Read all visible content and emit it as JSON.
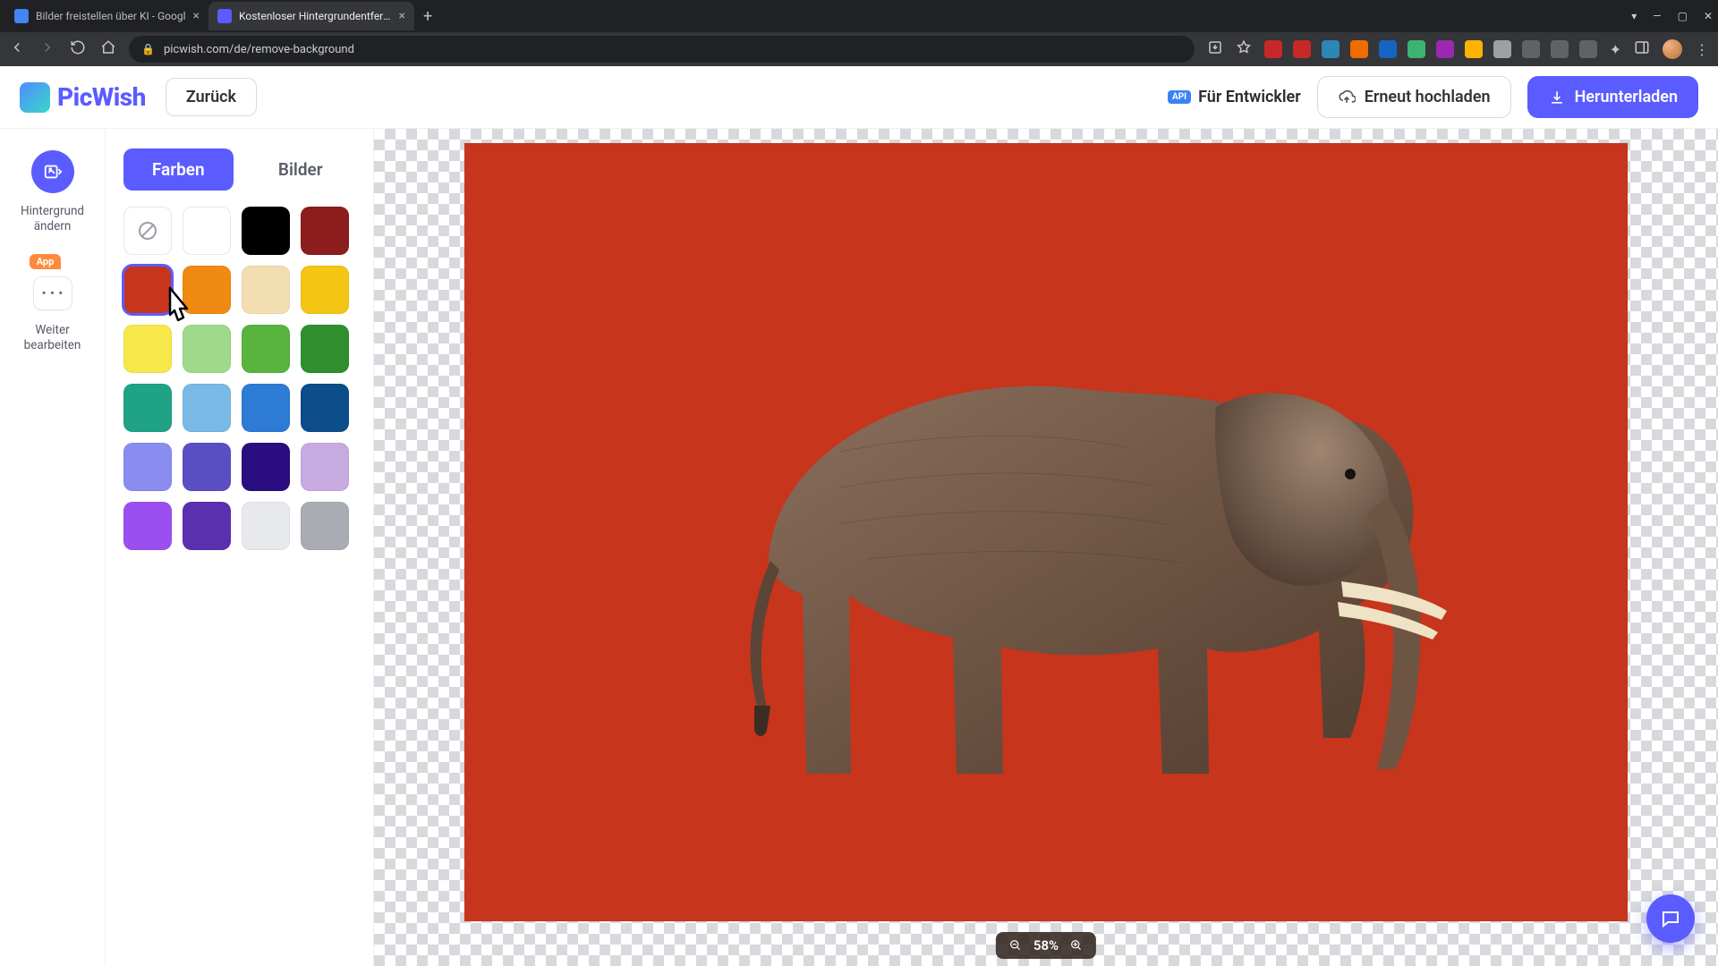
{
  "browser": {
    "tabs": [
      {
        "title": "Bilder freistellen über KI - Googl",
        "active": false,
        "favicon_bg": "#4285f4"
      },
      {
        "title": "Kostenloser Hintergrundentferne",
        "active": true,
        "favicon_bg": "#5b5cff"
      }
    ],
    "url": "picwish.com/de/remove-background",
    "ext_colors": [
      "#c62828",
      "#c62828",
      "#2b87b3",
      "#ef6c00",
      "#1565c0",
      "#3cb371",
      "#9c27b0",
      "#ffb300",
      "#9aa0a6",
      "#5f6368",
      "#5f6368",
      "#5f6368"
    ]
  },
  "header": {
    "logo_text": "PicWish",
    "back_label": "Zurück",
    "dev_badge": "API",
    "dev_label": "Für Entwickler",
    "reupload_label": "Erneut hochladen",
    "download_label": "Herunterladen"
  },
  "rail": {
    "change_bg_label": "Hintergrund\nändern",
    "app_badge": "App",
    "further_edit_label": "Weiter\nbearbeiten"
  },
  "panel": {
    "tabs": {
      "colors": "Farben",
      "images": "Bilder",
      "active": "colors"
    },
    "swatches": [
      {
        "type": "none"
      },
      {
        "color": "#ffffff",
        "type": "white"
      },
      {
        "color": "#000000"
      },
      {
        "color": "#8d1c1c"
      },
      {
        "color": "#c6351c",
        "selected": true
      },
      {
        "color": "#ef8b12"
      },
      {
        "color": "#f3deb1"
      },
      {
        "color": "#f3c613"
      },
      {
        "color": "#f6e84a"
      },
      {
        "color": "#9fd98a"
      },
      {
        "color": "#58b43e"
      },
      {
        "color": "#2f8f2f"
      },
      {
        "color": "#1fa384"
      },
      {
        "color": "#7ab8e6"
      },
      {
        "color": "#2e7bd6"
      },
      {
        "color": "#0c4d8a"
      },
      {
        "color": "#8a8cf0"
      },
      {
        "color": "#5a4fc2"
      },
      {
        "color": "#2b0d82"
      },
      {
        "color": "#c7abe0"
      },
      {
        "color": "#9b4ff0"
      },
      {
        "color": "#5a2fb0"
      },
      {
        "color": "#e8e9ec"
      },
      {
        "color": "#a9adb3"
      }
    ]
  },
  "canvas": {
    "bg_color": "#c6351c",
    "zoom_text": "58%"
  }
}
